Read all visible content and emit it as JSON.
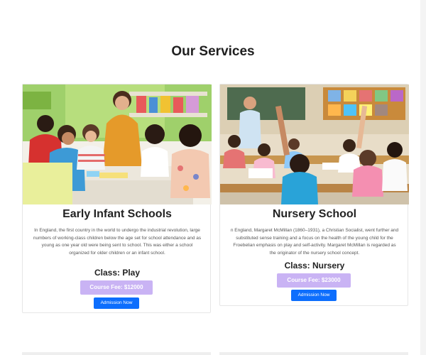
{
  "section": {
    "title": "Our Services"
  },
  "cards": [
    {
      "title": "Early Infant Schools",
      "description": "In England, the first country in the world to undergo the industrial revolution, large numbers of working-class children below the age set for school attendance and as young as one year old were being sent to school. This was either a school organized for older children or an infant school.",
      "class_label": "Class: Play",
      "fee_label": "Course Fee: $12000",
      "button_label": "Admission Now"
    },
    {
      "title": "Nursery School",
      "description": "n England, Margaret McMillan (1860–1931), a Christian Socialist, went further and substituted sense training and a focus on the health of the young child for the Froebelian emphasis on play and self-activity. Margaret McMillan is regarded as the originator of the nursery school concept.",
      "class_label": "Class: Nursery",
      "fee_label": "Course Fee: $23000",
      "button_label": "Admission Now"
    }
  ],
  "colors": {
    "fee_badge": "#c9b3f4",
    "button": "#0d6efd",
    "title_text": "#1f1f1f"
  }
}
